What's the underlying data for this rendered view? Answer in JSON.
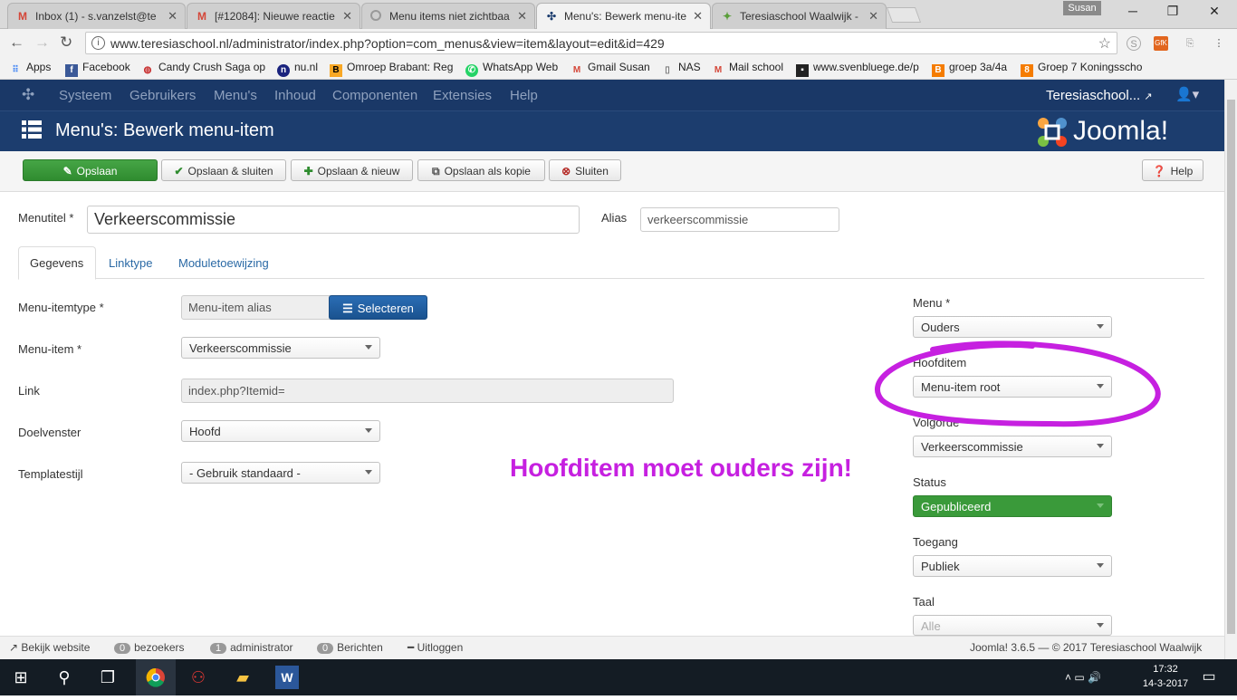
{
  "browser": {
    "tabs": [
      {
        "title": "Inbox (1) - s.vanzelst@te",
        "icon": "gmail-icon"
      },
      {
        "title": "[#12084]: Nieuwe reactie",
        "icon": "gmail-icon"
      },
      {
        "title": "Menu items niet zichtbaa",
        "icon": "loading-icon"
      },
      {
        "title": "Menu's: Bewerk menu-ite",
        "icon": "joomla-icon"
      },
      {
        "title": "Teresiaschool Waalwijk -",
        "icon": "site-icon"
      }
    ],
    "user_chip": "Susan",
    "url": "www.teresiaschool.nl/administrator/index.php?option=com_menus&view=item&layout=edit&id=429",
    "bookmarks": [
      {
        "label": "Apps",
        "icon": "apps-icon",
        "color": "#4285f4"
      },
      {
        "label": "Facebook",
        "icon": "facebook-icon",
        "color": "#3b5998"
      },
      {
        "label": "Candy Crush Saga op",
        "icon": "candy-icon",
        "color": "#c62828"
      },
      {
        "label": "nu.nl",
        "icon": "nu-icon",
        "color": "#1a237e"
      },
      {
        "label": "Omroep Brabant: Reg",
        "icon": "omroep-icon",
        "color": "#f9a825"
      },
      {
        "label": "WhatsApp Web",
        "icon": "whatsapp-icon",
        "color": "#25d366"
      },
      {
        "label": "Gmail Susan",
        "icon": "gmail-icon",
        "color": "#d44638"
      },
      {
        "label": "NAS",
        "icon": "page-icon",
        "color": "#777777"
      },
      {
        "label": "Mail school",
        "icon": "gmail-icon",
        "color": "#d44638"
      },
      {
        "label": "www.svenbluege.de/p",
        "icon": "sven-icon",
        "color": "#222222"
      },
      {
        "label": "groep 3a/4a",
        "icon": "blogger-icon",
        "color": "#f57c00"
      },
      {
        "label": "Groep 7 Koningsscho",
        "icon": "blogger-icon",
        "color": "#f57c00"
      }
    ]
  },
  "joomla": {
    "nav": [
      "Systeem",
      "Gebruikers",
      "Menu's",
      "Inhoud",
      "Componenten",
      "Extensies",
      "Help"
    ],
    "site_link": "Teresiaschool...",
    "page_title": "Menu's: Bewerk menu-item",
    "logo_text": "Joomla!",
    "toolbar": {
      "save": "Opslaan",
      "save_close": "Opslaan & sluiten",
      "save_new": "Opslaan & nieuw",
      "save_copy": "Opslaan als kopie",
      "close": "Sluiten",
      "help": "Help"
    },
    "form": {
      "title_label": "Menutitel *",
      "title_value": "Verkeerscommissie",
      "alias_label": "Alias",
      "alias_value": "verkeerscommissie",
      "tabs": [
        "Gegevens",
        "Linktype",
        "Moduletoewijzing"
      ],
      "type_label": "Menu-itemtype *",
      "type_value": "Menu-item alias",
      "select_button": "Selecteren",
      "item_label": "Menu-item *",
      "item_value": "Verkeerscommissie",
      "link_label": "Link",
      "link_value": "index.php?Itemid=",
      "target_label": "Doelvenster",
      "target_value": "Hoofd",
      "template_label": "Templatestijl",
      "template_value": "- Gebruik standaard -"
    },
    "sidebar": {
      "menu_label": "Menu *",
      "menu_value": "Ouders",
      "parent_label": "Hoofditem",
      "parent_value": "Menu-item root",
      "order_label": "Volgorde",
      "order_value": "Verkeerscommissie",
      "status_label": "Status",
      "status_value": "Gepubliceerd",
      "access_label": "Toegang",
      "access_value": "Publiek",
      "language_label": "Taal",
      "language_value": "Alle"
    },
    "annotation": "Hoofditem moet ouders zijn!",
    "status": {
      "view_site": "Bekijk website",
      "visitors_count": "0",
      "visitors": "bezoekers",
      "admin_count": "1",
      "admin": "administrator",
      "messages_count": "0",
      "messages": "Berichten",
      "logout": "Uitloggen",
      "copyright": "Joomla! 3.6.5 — © 2017 Teresiaschool Waalwijk"
    }
  },
  "taskbar": {
    "time": "17:32",
    "date": "14-3-2017"
  },
  "colors": {
    "nav_bg": "#1a3867",
    "header_bg": "#1c3d6e",
    "save_green": "#46a546",
    "annotation": "#c620e0"
  }
}
